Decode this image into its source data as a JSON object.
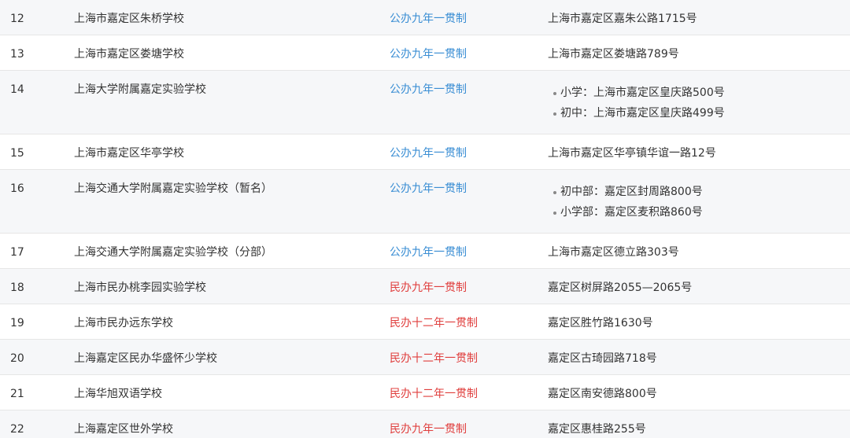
{
  "rows": [
    {
      "idx": "12",
      "name": "上海市嘉定区朱桥学校",
      "type": "公办九年一贯制",
      "kind": "public",
      "address": "上海市嘉定区嘉朱公路1715号"
    },
    {
      "idx": "13",
      "name": "上海市嘉定区娄塘学校",
      "type": "公办九年一贯制",
      "kind": "public",
      "address": "上海市嘉定区娄塘路789号"
    },
    {
      "idx": "14",
      "name": "上海大学附属嘉定实验学校",
      "type": "公办九年一贯制",
      "kind": "public",
      "addresses": [
        "小学：上海市嘉定区皇庆路500号",
        "初中：上海市嘉定区皇庆路499号"
      ]
    },
    {
      "idx": "15",
      "name": "上海市嘉定区华亭学校",
      "type": "公办九年一贯制",
      "kind": "public",
      "address": "上海市嘉定区华亭镇华谊一路12号"
    },
    {
      "idx": "16",
      "name": "上海交通大学附属嘉定实验学校（暂名）",
      "type": "公办九年一贯制",
      "kind": "public",
      "addresses": [
        "初中部：嘉定区封周路800号",
        "小学部：嘉定区麦积路860号"
      ]
    },
    {
      "idx": "17",
      "name": "上海交通大学附属嘉定实验学校（分部）",
      "type": "公办九年一贯制",
      "kind": "public",
      "address": "上海市嘉定区德立路303号"
    },
    {
      "idx": "18",
      "name": "上海市民办桃李园实验学校",
      "type": "民办九年一贯制",
      "kind": "private",
      "address": "嘉定区树屏路2055—2065号"
    },
    {
      "idx": "19",
      "name": "上海市民办远东学校",
      "type": "民办十二年一贯制",
      "kind": "private",
      "address": "嘉定区胜竹路1630号"
    },
    {
      "idx": "20",
      "name": "上海嘉定区民办华盛怀少学校",
      "type": "民办十二年一贯制",
      "kind": "private",
      "address": "嘉定区古琦园路718号"
    },
    {
      "idx": "21",
      "name": "上海华旭双语学校",
      "type": "民办十二年一贯制",
      "kind": "private",
      "address": "嘉定区南安德路800号"
    },
    {
      "idx": "22",
      "name": "上海嘉定区世外学校",
      "type": "民办九年一贯制",
      "kind": "private",
      "address": "嘉定区惠桂路255号"
    }
  ],
  "colors": {
    "public": "#3a8ed4",
    "private": "#e0403f",
    "stripe": "#f6f7f9",
    "border": "#e6e6e6",
    "text": "#333333"
  }
}
